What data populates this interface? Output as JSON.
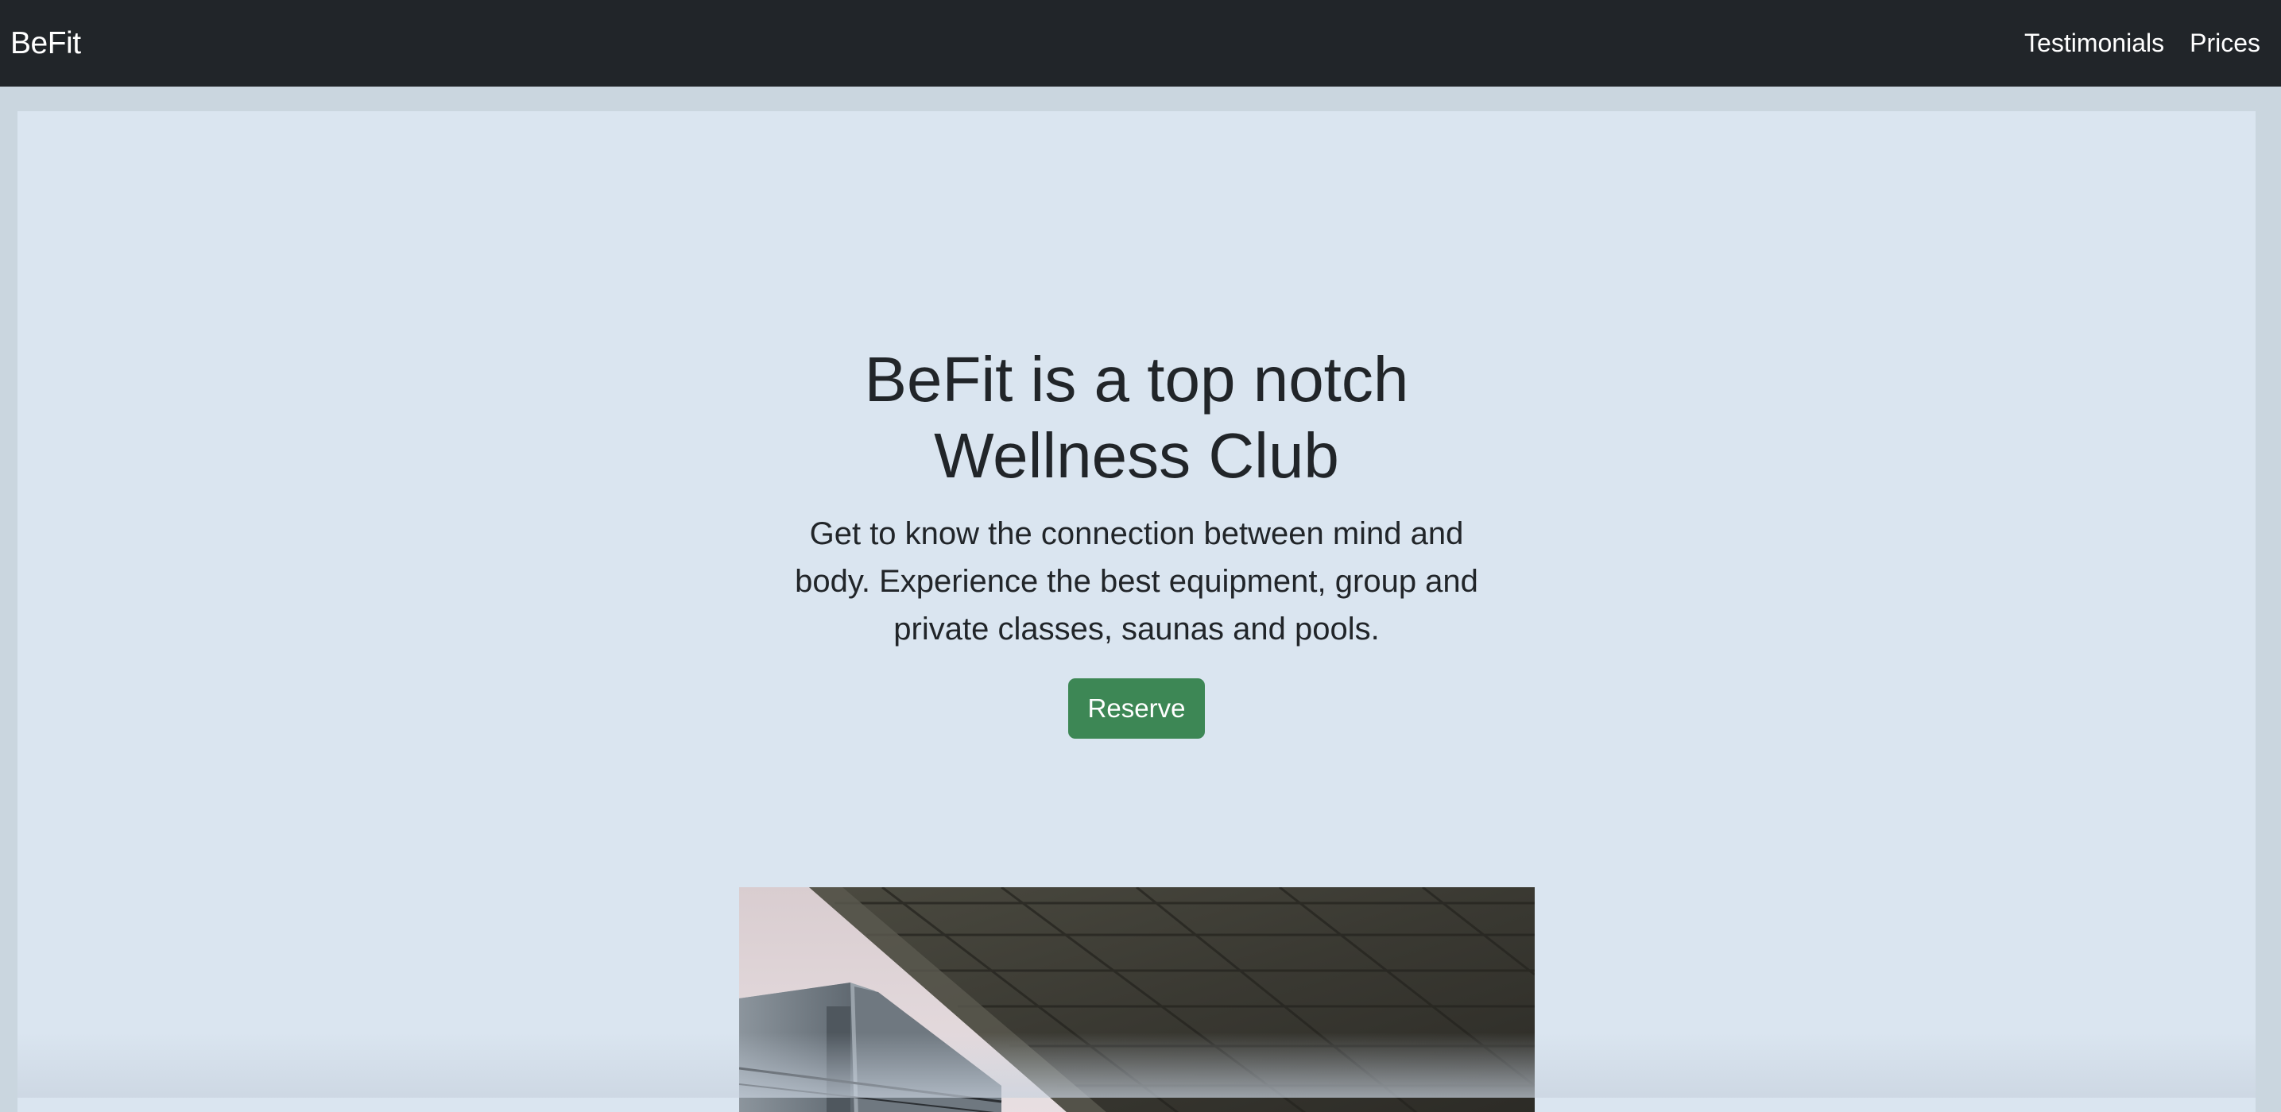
{
  "navbar": {
    "brand": "BeFit",
    "links": [
      {
        "label": "Testimonials"
      },
      {
        "label": "Prices"
      }
    ],
    "background_color": "#212529"
  },
  "hero": {
    "title": "BeFit is a top notch Wellness Club",
    "lead": "Get to know the connection between mind and body. Experience the best equipment, group and private classes, saunas and pools.",
    "cta_label": "Reserve",
    "cta_color": "#3d8755",
    "background_color": "#dae5f0",
    "image_subject": "building-exterior-photo"
  }
}
